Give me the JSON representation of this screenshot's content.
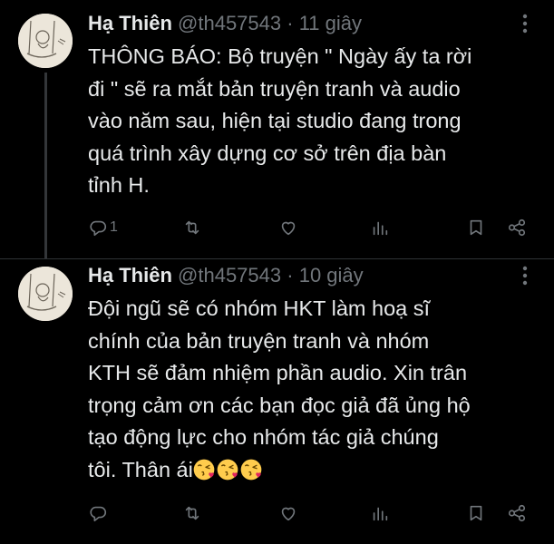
{
  "colors": {
    "background": "#000000",
    "text": "#e7e9ea",
    "muted": "#71767b",
    "divider": "#2f3336",
    "emoji": "#ffcc4d",
    "emoji_heart": "#e0245e"
  },
  "tweets": [
    {
      "name": "Hạ Thiên",
      "handle": "@th457543",
      "separator": "·",
      "time": "11 giây",
      "text_lines": [
        "THÔNG BÁO: Bộ truyện \" Ngày ấy ta rời",
        "đi \" sẽ ra mắt bản truyện tranh và audio",
        "vào năm sau, hiện tại studio đang trong",
        "quá trình xây dựng cơ sở trên địa bàn",
        "tỉnh H."
      ],
      "reply_count": "1",
      "icons": [
        "reply-icon",
        "retweet-icon",
        "like-icon",
        "views-icon",
        "bookmark-icon",
        "share-icon"
      ]
    },
    {
      "name": "Hạ Thiên",
      "handle": "@th457543",
      "separator": "·",
      "time": "10 giây",
      "text_lines": [
        "Đội ngũ sẽ có nhóm HKT làm hoạ sĩ",
        "chính của bản truyện tranh và nhóm",
        "KTH sẽ đảm nhiệm phần audio. Xin trân",
        "trọng cảm ơn các bạn đọc giả đã ủng hộ",
        "tạo động lực cho nhóm tác giả chúng",
        "tôi. Thân ái"
      ],
      "emoji": "face-blowing-kiss",
      "emoji_count": 3,
      "reply_count": "",
      "icons": [
        "reply-icon",
        "retweet-icon",
        "like-icon",
        "views-icon",
        "bookmark-icon",
        "share-icon"
      ]
    }
  ]
}
